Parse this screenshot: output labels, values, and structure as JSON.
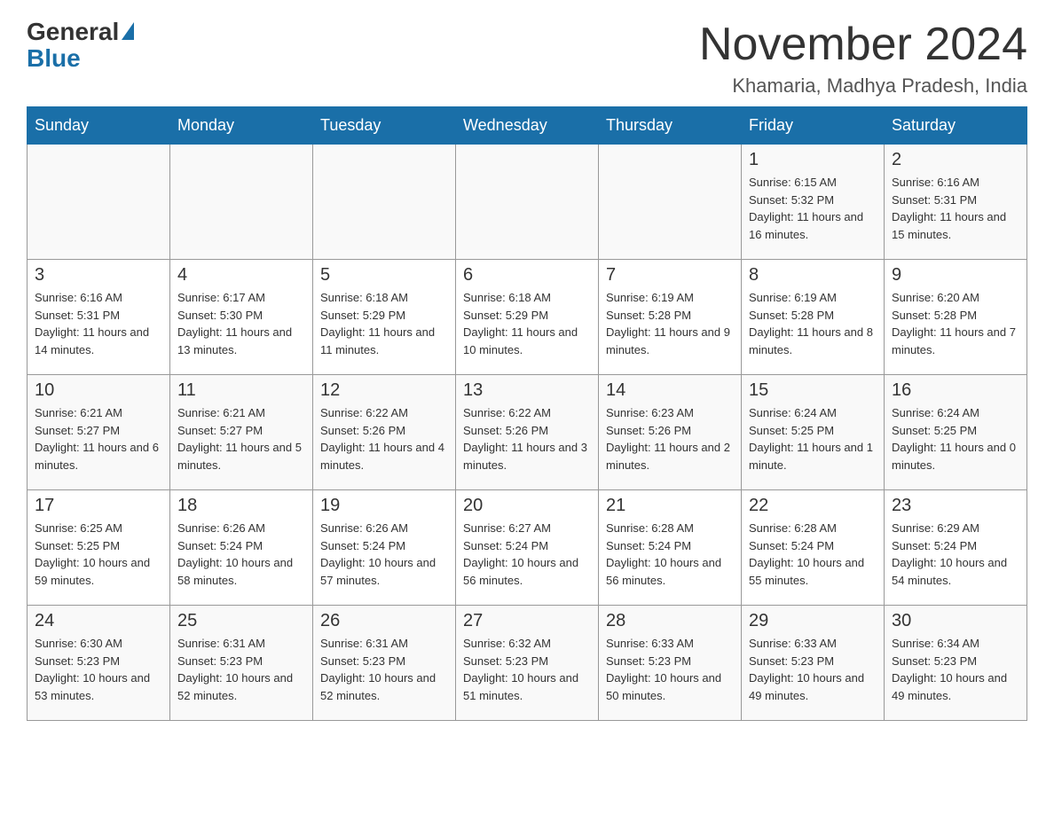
{
  "header": {
    "logo_general": "General",
    "logo_blue": "Blue",
    "month_title": "November 2024",
    "location": "Khamaria, Madhya Pradesh, India"
  },
  "days_of_week": [
    "Sunday",
    "Monday",
    "Tuesday",
    "Wednesday",
    "Thursday",
    "Friday",
    "Saturday"
  ],
  "weeks": [
    {
      "id": "week1",
      "days": [
        {
          "number": "",
          "info": ""
        },
        {
          "number": "",
          "info": ""
        },
        {
          "number": "",
          "info": ""
        },
        {
          "number": "",
          "info": ""
        },
        {
          "number": "",
          "info": ""
        },
        {
          "number": "1",
          "info": "Sunrise: 6:15 AM\nSunset: 5:32 PM\nDaylight: 11 hours and 16 minutes."
        },
        {
          "number": "2",
          "info": "Sunrise: 6:16 AM\nSunset: 5:31 PM\nDaylight: 11 hours and 15 minutes."
        }
      ]
    },
    {
      "id": "week2",
      "days": [
        {
          "number": "3",
          "info": "Sunrise: 6:16 AM\nSunset: 5:31 PM\nDaylight: 11 hours and 14 minutes."
        },
        {
          "number": "4",
          "info": "Sunrise: 6:17 AM\nSunset: 5:30 PM\nDaylight: 11 hours and 13 minutes."
        },
        {
          "number": "5",
          "info": "Sunrise: 6:18 AM\nSunset: 5:29 PM\nDaylight: 11 hours and 11 minutes."
        },
        {
          "number": "6",
          "info": "Sunrise: 6:18 AM\nSunset: 5:29 PM\nDaylight: 11 hours and 10 minutes."
        },
        {
          "number": "7",
          "info": "Sunrise: 6:19 AM\nSunset: 5:28 PM\nDaylight: 11 hours and 9 minutes."
        },
        {
          "number": "8",
          "info": "Sunrise: 6:19 AM\nSunset: 5:28 PM\nDaylight: 11 hours and 8 minutes."
        },
        {
          "number": "9",
          "info": "Sunrise: 6:20 AM\nSunset: 5:28 PM\nDaylight: 11 hours and 7 minutes."
        }
      ]
    },
    {
      "id": "week3",
      "days": [
        {
          "number": "10",
          "info": "Sunrise: 6:21 AM\nSunset: 5:27 PM\nDaylight: 11 hours and 6 minutes."
        },
        {
          "number": "11",
          "info": "Sunrise: 6:21 AM\nSunset: 5:27 PM\nDaylight: 11 hours and 5 minutes."
        },
        {
          "number": "12",
          "info": "Sunrise: 6:22 AM\nSunset: 5:26 PM\nDaylight: 11 hours and 4 minutes."
        },
        {
          "number": "13",
          "info": "Sunrise: 6:22 AM\nSunset: 5:26 PM\nDaylight: 11 hours and 3 minutes."
        },
        {
          "number": "14",
          "info": "Sunrise: 6:23 AM\nSunset: 5:26 PM\nDaylight: 11 hours and 2 minutes."
        },
        {
          "number": "15",
          "info": "Sunrise: 6:24 AM\nSunset: 5:25 PM\nDaylight: 11 hours and 1 minute."
        },
        {
          "number": "16",
          "info": "Sunrise: 6:24 AM\nSunset: 5:25 PM\nDaylight: 11 hours and 0 minutes."
        }
      ]
    },
    {
      "id": "week4",
      "days": [
        {
          "number": "17",
          "info": "Sunrise: 6:25 AM\nSunset: 5:25 PM\nDaylight: 10 hours and 59 minutes."
        },
        {
          "number": "18",
          "info": "Sunrise: 6:26 AM\nSunset: 5:24 PM\nDaylight: 10 hours and 58 minutes."
        },
        {
          "number": "19",
          "info": "Sunrise: 6:26 AM\nSunset: 5:24 PM\nDaylight: 10 hours and 57 minutes."
        },
        {
          "number": "20",
          "info": "Sunrise: 6:27 AM\nSunset: 5:24 PM\nDaylight: 10 hours and 56 minutes."
        },
        {
          "number": "21",
          "info": "Sunrise: 6:28 AM\nSunset: 5:24 PM\nDaylight: 10 hours and 56 minutes."
        },
        {
          "number": "22",
          "info": "Sunrise: 6:28 AM\nSunset: 5:24 PM\nDaylight: 10 hours and 55 minutes."
        },
        {
          "number": "23",
          "info": "Sunrise: 6:29 AM\nSunset: 5:24 PM\nDaylight: 10 hours and 54 minutes."
        }
      ]
    },
    {
      "id": "week5",
      "days": [
        {
          "number": "24",
          "info": "Sunrise: 6:30 AM\nSunset: 5:23 PM\nDaylight: 10 hours and 53 minutes."
        },
        {
          "number": "25",
          "info": "Sunrise: 6:31 AM\nSunset: 5:23 PM\nDaylight: 10 hours and 52 minutes."
        },
        {
          "number": "26",
          "info": "Sunrise: 6:31 AM\nSunset: 5:23 PM\nDaylight: 10 hours and 52 minutes."
        },
        {
          "number": "27",
          "info": "Sunrise: 6:32 AM\nSunset: 5:23 PM\nDaylight: 10 hours and 51 minutes."
        },
        {
          "number": "28",
          "info": "Sunrise: 6:33 AM\nSunset: 5:23 PM\nDaylight: 10 hours and 50 minutes."
        },
        {
          "number": "29",
          "info": "Sunrise: 6:33 AM\nSunset: 5:23 PM\nDaylight: 10 hours and 49 minutes."
        },
        {
          "number": "30",
          "info": "Sunrise: 6:34 AM\nSunset: 5:23 PM\nDaylight: 10 hours and 49 minutes."
        }
      ]
    }
  ]
}
